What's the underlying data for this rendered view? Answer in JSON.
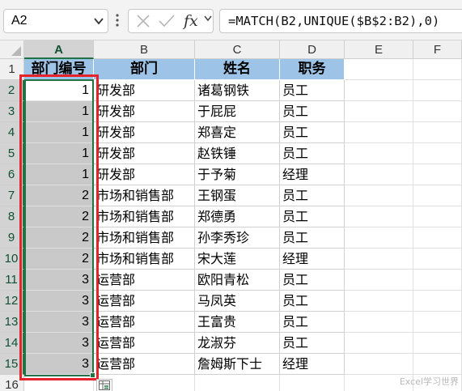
{
  "name_box": {
    "value": "A2"
  },
  "formula_bar": {
    "fx_label": "fx",
    "formula": "=MATCH(B2,UNIQUE($B$2:B2),0)"
  },
  "columns": [
    "A",
    "B",
    "C",
    "D",
    "E",
    "F"
  ],
  "rows": [
    "1",
    "2",
    "3",
    "4",
    "5",
    "6",
    "7",
    "8",
    "9",
    "10",
    "11",
    "12",
    "13",
    "14",
    "15",
    "16"
  ],
  "table": {
    "headers": [
      "部门编号",
      "部门",
      "姓名",
      "职务"
    ],
    "rows": [
      [
        "1",
        "研发部",
        "诸葛钢铁",
        "员工"
      ],
      [
        "1",
        "研发部",
        "于屁屁",
        "员工"
      ],
      [
        "1",
        "研发部",
        "郑喜定",
        "员工"
      ],
      [
        "1",
        "研发部",
        "赵铁锤",
        "员工"
      ],
      [
        "1",
        "研发部",
        "于予菊",
        "经理"
      ],
      [
        "2",
        "市场和销售部",
        "王钢蛋",
        "员工"
      ],
      [
        "2",
        "市场和销售部",
        "郑德勇",
        "员工"
      ],
      [
        "2",
        "市场和销售部",
        "孙李秀珍",
        "员工"
      ],
      [
        "2",
        "市场和销售部",
        "宋大莲",
        "经理"
      ],
      [
        "3",
        "运营部",
        "欧阳青松",
        "员工"
      ],
      [
        "3",
        "运营部",
        "马凤英",
        "员工"
      ],
      [
        "3",
        "运营部",
        "王富贵",
        "员工"
      ],
      [
        "3",
        "运营部",
        "龙淑芬",
        "员工"
      ],
      [
        "3",
        "运营部",
        "詹姆斯下士",
        "经理"
      ]
    ]
  },
  "colors": {
    "header_fill": "#9dc3e6",
    "selection_fill": "#c9c9c9",
    "selection_border": "#217346",
    "highlight_box": "#e5232a"
  },
  "watermark": "Excel学习世界",
  "icons": [
    "chevron-down-icon",
    "cancel-x-icon",
    "check-icon",
    "fx-icon",
    "select-all-triangle-icon",
    "quick-analysis-icon"
  ]
}
